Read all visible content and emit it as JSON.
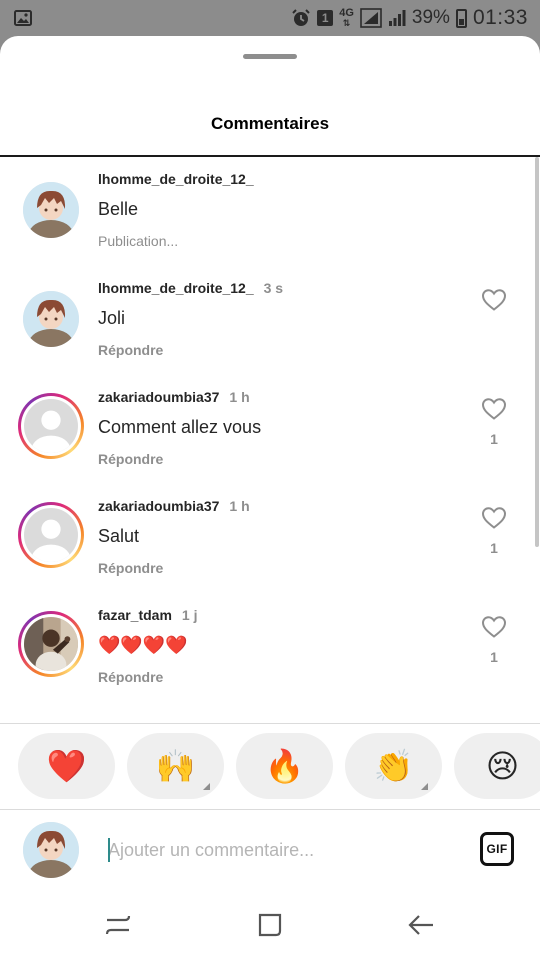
{
  "status_bar": {
    "battery": "39%",
    "time": "01:33",
    "network": "4G",
    "sim_badge": "1"
  },
  "sheet": {
    "title": "Commentaires"
  },
  "comments": [
    {
      "username": "lhomme_de_droite_12_",
      "time": "",
      "text": "Belle",
      "meta": "Publication...",
      "likes": "",
      "avatar": "anime-avatar-icon"
    },
    {
      "username": "lhomme_de_droite_12_",
      "time": "3 s",
      "text": "Joli",
      "meta": "Répondre",
      "likes": "",
      "avatar": "anime-avatar-icon"
    },
    {
      "username": "zakariadoumbia37",
      "time": "1 h",
      "text": "Comment allez vous",
      "meta": "Répondre",
      "likes": "1",
      "avatar": "default-avatar-icon"
    },
    {
      "username": "zakariadoumbia37",
      "time": "1 h",
      "text": "Salut",
      "meta": "Répondre",
      "likes": "1",
      "avatar": "default-avatar-icon"
    },
    {
      "username": "fazar_tdam",
      "time": "1 j",
      "text": "❤️❤️❤️❤️",
      "meta": "Répondre",
      "likes": "1",
      "avatar": "photo-avatar-icon"
    }
  ],
  "emoji_bar": [
    "❤️",
    "🙌",
    "🔥",
    "👏",
    "😢"
  ],
  "composer": {
    "placeholder": "Ajouter un commentaire...",
    "gif_label": "GIF"
  },
  "colors": {
    "accent_ring_start": "#f58529",
    "accent_ring_end": "#dd2a7b",
    "secondary_text": "#8e8e8e",
    "status_bar": "#8c8c8c"
  }
}
